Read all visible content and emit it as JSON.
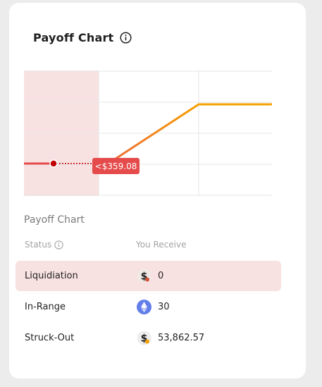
{
  "card": {
    "title": "Payoff Chart",
    "section_label": "Payoff Chart"
  },
  "chart": {
    "tooltip": "<$359.08",
    "colors": {
      "loss_zone": "#f8e1e1",
      "loss_line": "#e54b4b",
      "ramp_start": "#f06a3a",
      "profit_line": "#f5a000",
      "grid": "#e6e6e6",
      "marker": "#c00000"
    }
  },
  "table": {
    "headers": {
      "status": "Status",
      "receive": "You Receive"
    },
    "rows": [
      {
        "status": "Liquidiation",
        "icon": "dollar-coin-icon",
        "amount": "0",
        "highlight": true
      },
      {
        "status": "In-Range",
        "icon": "ethereum-icon",
        "amount": "30",
        "highlight": false
      },
      {
        "status": "Struck-Out",
        "icon": "dollar-coin-icon",
        "amount": "53,862.57",
        "highlight": false
      }
    ]
  }
}
